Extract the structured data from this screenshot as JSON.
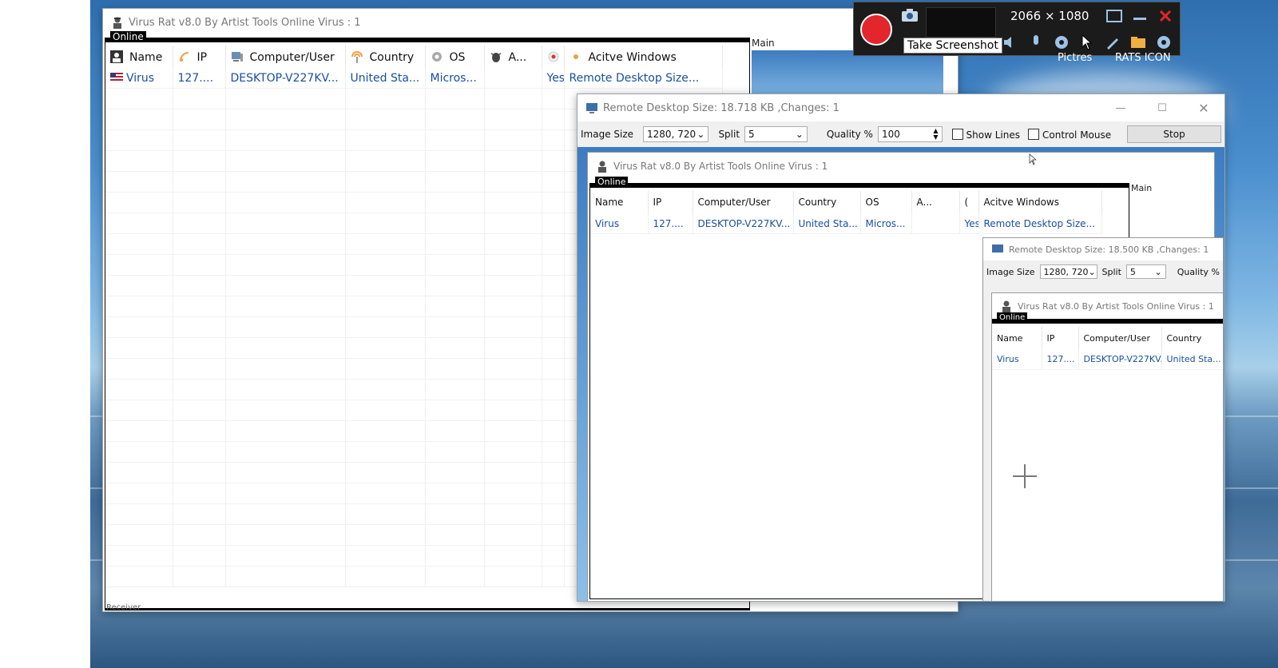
{
  "main_window": {
    "title": "Virus Rat v8.0 By Artist Tools Online Virus : 1",
    "group_label": "Online",
    "side_group_label": "Main",
    "side_tiles": [
      "Pictres",
      "RATS ICON"
    ],
    "status_stub": "Receiver",
    "columns": [
      "Name",
      "IP",
      "Computer/User",
      "Country",
      "OS",
      "A...",
      "(",
      "Acitve Windows"
    ],
    "rows": [
      {
        "name": "Virus",
        "ip": "127....",
        "computer": "DESKTOP-V227KV...",
        "country": "United Sta...",
        "os": "Micros...",
        "a": "",
        "c": "Yes",
        "active": "Remote Desktop  Size..."
      }
    ]
  },
  "remote_window": {
    "title": "Remote Desktop  Size: 18.718 KB ,Changes: 1",
    "image_size_label": "Image Size",
    "image_size_value": "1280, 720",
    "split_label": "Split",
    "split_value": "5",
    "quality_label": "Quality %",
    "quality_value": "100",
    "show_lines_label": "Show Lines",
    "control_mouse_label": "Control Mouse",
    "stop_label": "Stop"
  },
  "nested_level1": {
    "title": "Virus Rat v8.0 By Artist Tools Online Virus : 1",
    "group_label": "Online",
    "side_group_label": "Main"
  },
  "nested_remote": {
    "title": "Remote Desktop  Size: 18.500 KB ,Changes: 1",
    "image_size_label": "Image Size",
    "image_size_value": "1280, 720",
    "split_label": "Split",
    "split_value": "5",
    "quality_label": "Quality %"
  },
  "nested_level2": {
    "title": "Virus Rat v8.0 By Artist Tools Online Virus : 1",
    "group_label": "Online",
    "columns": [
      "Name",
      "IP",
      "Computer/User",
      "Country"
    ],
    "row": {
      "name": "Virus",
      "ip": "127....",
      "computer": "DESKTOP-V227KV...",
      "country": "United Sta..."
    }
  },
  "recorder": {
    "resolution": "2066 × 1080",
    "tooltip": "Take Screenshot"
  },
  "colors": {
    "record": "#e3262b",
    "link_text": "#1a4fa0"
  }
}
